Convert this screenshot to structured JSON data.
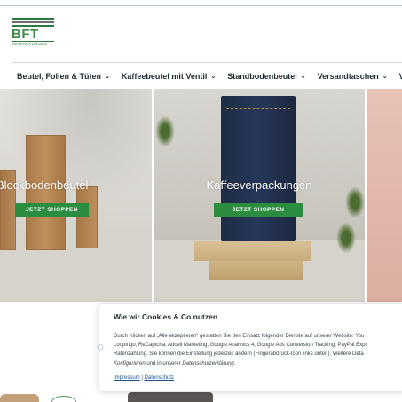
{
  "brand": {
    "logo_letters": "BFT",
    "logo_sub": "VERPACKUNGEN"
  },
  "nav": {
    "items": [
      {
        "label": "Beutel, Folien & Tüten"
      },
      {
        "label": "Kaffeebeutel mit Ventil"
      },
      {
        "label": "Standbodenbeutel"
      },
      {
        "label": "Versandtaschen"
      },
      {
        "label": "Ve"
      }
    ]
  },
  "heroes": [
    {
      "title": "Blockbodenbeutel",
      "button": "JETZT SHOPPEN"
    },
    {
      "title": "Kaffeeverpackungen",
      "button": "JETZT SHOPPEN"
    }
  ],
  "cookie": {
    "title": "Wie wir Cookies & Co nutzen",
    "line1": "Durch Klicken auf „Alle akzeptieren“ gestatten Sie den Einsatz folgender Dienste auf unserer Website: You",
    "line2": "Loopingo, ReCaptcha, Adcell Marketing, Google Analytics 4, Google Ads Conversion Tracking, PayPal Expr",
    "line3": "Ratenzahlung. Sie können die Einstellung jederzeit ändern (Fingerabdruck-Icon links unten). Weitere Deta",
    "line4_link": "Konfigurieren",
    "line4_mid": " und in unserer ",
    "line4_link2": "Datenschutzerklärung",
    "line4_end": ".",
    "impressum": "Impressum",
    "separator": "|",
    "datenschutz": "Datenschutz"
  },
  "colors": {
    "accent_green": "#2b8d3f",
    "link_blue": "#1d4f8a"
  },
  "icons": {
    "nav_chevron": "chevron-down-icon",
    "fingerprint": "fingerprint-icon"
  }
}
